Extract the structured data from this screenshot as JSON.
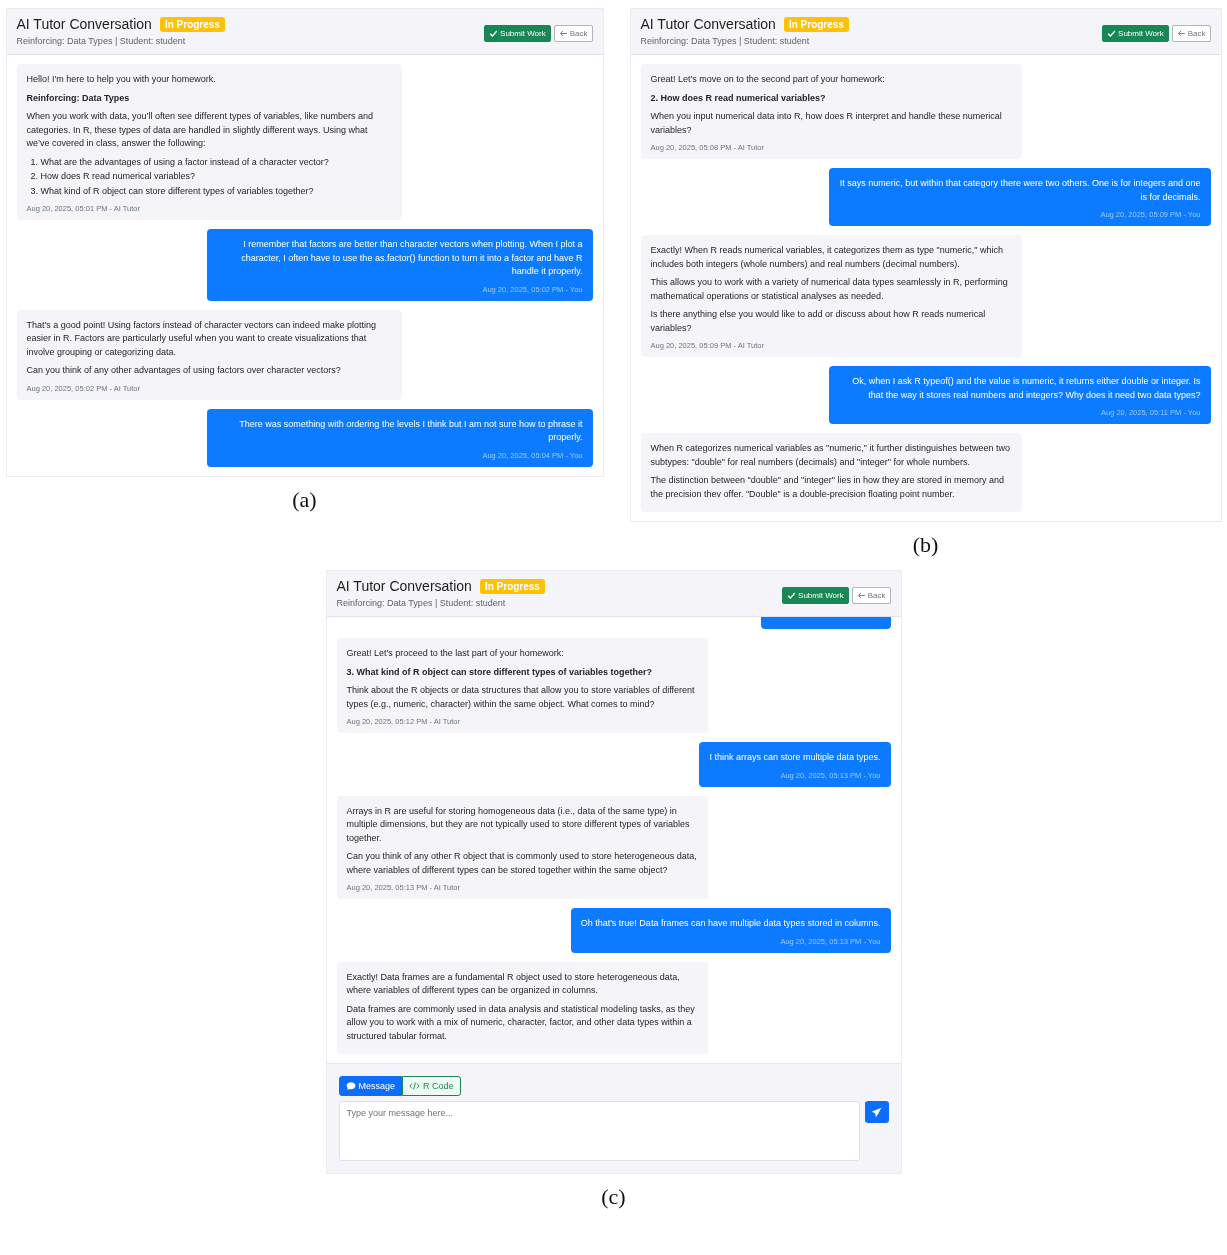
{
  "panels": [
    {
      "caption": "(a)",
      "header": {
        "title": "AI Tutor Conversation",
        "status": "In Progress",
        "subtitle": "Reinforcing: Data Types | Student: student",
        "buttons": [
          {
            "kind": "submit",
            "label": "Submit Work"
          },
          {
            "kind": "back",
            "label": "Back"
          }
        ]
      },
      "messages": [
        {
          "kind": "tutor",
          "blocks": [
            {
              "kind": "text",
              "text": "Hello! I'm here to help you with your homework."
            },
            {
              "kind": "heading",
              "text": "Reinforcing: Data Types"
            },
            {
              "kind": "text",
              "text": "When you work with data, you’ll often see different types of variables, like numbers and categories. In R, these types of data are handled in slightly different ways. Using what we’ve covered in class, answer the following:"
            },
            {
              "kind": "list",
              "items": [
                "1. What are the advantages of using a factor instead of a character vector?",
                "2. How does R read numerical variables?",
                "3. What kind of R object can store different types of variables together?"
              ]
            }
          ],
          "meta": "Aug 20, 2025, 05:01 PM - AI Tutor"
        },
        {
          "kind": "user",
          "blocks": [
            {
              "kind": "text",
              "text": "I remember that factors are better than character vectors when plotting. When I plot a character, I often have to use the as.factor() function to turn it into a factor and have R handle it properly."
            }
          ],
          "meta": "Aug 20, 2025, 05:02 PM - You"
        },
        {
          "kind": "tutor",
          "blocks": [
            {
              "kind": "text",
              "text": "That's a good point! Using factors instead of character vectors can indeed make plotting easier in R. Factors are particularly useful when you want to create visualizations that involve grouping or categorizing data."
            },
            {
              "kind": "text",
              "text": "Can you think of any other advantages of using factors over character vectors?"
            }
          ],
          "meta": "Aug 20, 2025, 05:02 PM - AI Tutor"
        },
        {
          "kind": "user",
          "blocks": [
            {
              "kind": "text",
              "text": "There was something with ordering the levels I think but I am not sure how to phrase it properly."
            }
          ],
          "meta": "Aug 20, 2025, 05:04 PM - You"
        }
      ]
    },
    {
      "caption": "(b)",
      "header": {
        "title": "AI Tutor Conversation",
        "status": "In Progress",
        "subtitle": "Reinforcing: Data Types | Student: student",
        "buttons": [
          {
            "kind": "submit",
            "label": "Submit Work"
          },
          {
            "kind": "back",
            "label": "Back"
          }
        ]
      },
      "messages": [
        {
          "kind": "tutor",
          "blocks": [
            {
              "kind": "text",
              "text": "Great! Let's move on to the second part of your homework:"
            },
            {
              "kind": "heading",
              "text": "2. How does R read numerical variables?"
            },
            {
              "kind": "text",
              "text": "When you input numerical data into R, how does R interpret and handle these numerical variables?"
            }
          ],
          "meta": "Aug 20, 2025, 05:08 PM - AI Tutor"
        },
        {
          "kind": "user",
          "blocks": [
            {
              "kind": "text",
              "text": "It says numeric, but within that category there were two others. One is for integers and one is for decimals."
            }
          ],
          "meta": "Aug 20, 2025, 05:09 PM - You"
        },
        {
          "kind": "tutor",
          "blocks": [
            {
              "kind": "text",
              "text": "Exactly! When R reads numerical variables, it categorizes them as type \"numeric,\" which includes both integers (whole numbers) and real numbers (decimal numbers)."
            },
            {
              "kind": "text",
              "text": "This allows you to work with a variety of numerical data types seamlessly in R, performing mathematical operations or statistical analyses as needed."
            },
            {
              "kind": "text",
              "text": "Is there anything else you would like to add or discuss about how R reads numerical variables?"
            }
          ],
          "meta": "Aug 20, 2025, 05:09 PM - AI Tutor"
        },
        {
          "kind": "user",
          "blocks": [
            {
              "kind": "text",
              "text": "Ok, when I ask R typeof() and the value is numeric, it returns either double or integer. Is that the way it stores real numbers and integers? Why does it need two data types?"
            }
          ],
          "meta": "Aug 20, 2025, 05:11 PM - You"
        },
        {
          "kind": "tutor",
          "blocks": [
            {
              "kind": "text",
              "text": "When R categorizes numerical variables as \"numeric,\" it further distinguishes between two subtypes: \"double\" for real numbers (decimals) and \"integer\" for whole numbers."
            },
            {
              "kind": "text",
              "text": "The distinction between \"double\" and \"integer\" lies in how they are stored in memory and the precision thev offer. \"Double\" is a double-precision floating point number."
            }
          ]
        }
      ]
    },
    {
      "caption": "(c)",
      "header": {
        "title": "AI Tutor Conversation",
        "status": "In Progress",
        "subtitle": "Reinforcing: Data Types | Student: student",
        "buttons": [
          {
            "kind": "submit",
            "label": "Submit Work"
          },
          {
            "kind": "back",
            "label": "Back"
          }
        ]
      },
      "messages": [
        {
          "kind": "stub"
        },
        {
          "kind": "tutor",
          "blocks": [
            {
              "kind": "text",
              "text": "Great! Let's proceed to the last part of your homework:"
            },
            {
              "kind": "heading",
              "text": "3. What kind of R object can store different types of variables together?"
            },
            {
              "kind": "text",
              "text": "Think about the R objects or data structures that allow you to store variables of different types (e.g., numeric, character) within the same object. What comes to mind?"
            }
          ],
          "meta": "Aug 20, 2025, 05:12 PM - AI Tutor"
        },
        {
          "kind": "user",
          "blocks": [
            {
              "kind": "text",
              "text": "I think arrays can store multiple data types."
            }
          ],
          "meta": "Aug 20, 2025, 05:13 PM - You"
        },
        {
          "kind": "tutor",
          "blocks": [
            {
              "kind": "text",
              "text": "Arrays in R are useful for storing homogeneous data (i.e., data of the same type) in multiple dimensions, but they are not typically used to store different types of variables together."
            },
            {
              "kind": "text",
              "text": "Can you think of any other R object that is commonly used to store heterogeneous data, where variables of different types can be stored together within the same object?"
            }
          ],
          "meta": "Aug 20, 2025, 05:13 PM - AI Tutor"
        },
        {
          "kind": "user",
          "blocks": [
            {
              "kind": "text",
              "text": "Oh that's true! Data frames can have multiple data types stored in columns."
            }
          ],
          "meta": "Aug 20, 2025, 05:13 PM - You"
        },
        {
          "kind": "tutor",
          "blocks": [
            {
              "kind": "text",
              "text": "Exactly! Data frames are a fundamental R object used to store heterogeneous data, where variables of different types can be organized in columns."
            },
            {
              "kind": "text",
              "text": "Data frames are commonly used in data analysis and statistical modeling tasks, as they allow you to work with a mix of numeric, character, factor, and other data types within a structured tabular format."
            }
          ]
        }
      ],
      "composer": {
        "modes": [
          {
            "kind": "message",
            "label": "Message",
            "selected": true
          },
          {
            "kind": "code",
            "label": "R Code",
            "selected": false
          }
        ],
        "placeholder": "Type your message here..."
      }
    }
  ]
}
